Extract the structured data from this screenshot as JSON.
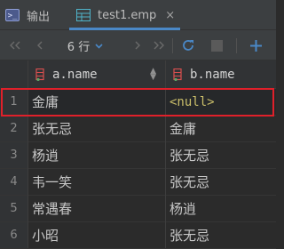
{
  "tabs": [
    {
      "label": "输出",
      "icon": "terminal-icon"
    },
    {
      "label": "test1.emp",
      "icon": "table-grid-icon",
      "close": "×"
    }
  ],
  "toolbar": {
    "rows_label": "6 行",
    "icons": [
      "first-page-icon",
      "prev-page-icon",
      "next-page-icon",
      "last-page-icon",
      "refresh-icon",
      "stop-icon",
      "add-row-icon"
    ]
  },
  "table": {
    "columns": [
      "a.name",
      "b.name"
    ],
    "rows": [
      {
        "num": "1",
        "a": "金庸",
        "b": "<null>"
      },
      {
        "num": "2",
        "a": "张无忌",
        "b": "金庸"
      },
      {
        "num": "3",
        "a": "杨逍",
        "b": "张无忌"
      },
      {
        "num": "4",
        "a": "韦一笑",
        "b": "张无忌"
      },
      {
        "num": "5",
        "a": "常遇春",
        "b": "杨逍"
      },
      {
        "num": "6",
        "a": "小昭",
        "b": "张无忌"
      }
    ]
  },
  "colors": {
    "accent": "#4a88c7",
    "selection_border": "#e0202a",
    "null_text": "#cbbf6a"
  }
}
